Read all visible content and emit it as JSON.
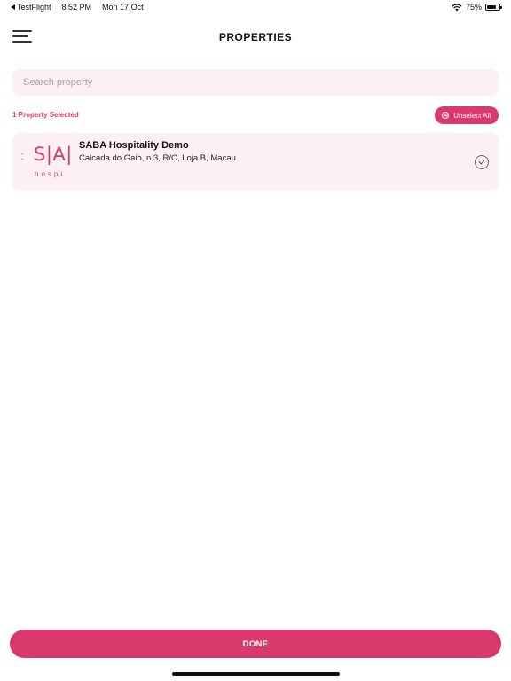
{
  "status_bar": {
    "back_app": "TestFlight",
    "time": "8:52 PM",
    "date": "Mon 17 Oct",
    "battery": "75%",
    "battery_level": 0.75,
    "icons": [
      "back-arrow-icon",
      "wifi-icon",
      "battery-icon"
    ]
  },
  "nav": {
    "title": "PROPERTIES",
    "menu_icon": "hamburger-menu-icon"
  },
  "search": {
    "placeholder": "Search property",
    "value": ""
  },
  "selection": {
    "count_text": "1 Property Selected",
    "unselect_label": "Unselect All",
    "unselect_icon": "check-circle-icon"
  },
  "properties": [
    {
      "name": "SABA Hospitality Demo",
      "address": "Calcada do Gaio, n 3, R/C, Loja B, Macau",
      "logo_mark": "S|A|",
      "logo_sub": "hospi",
      "selected": true,
      "selected_icon": "check-circle-icon"
    }
  ],
  "footer": {
    "done_label": "DONE"
  },
  "colors": {
    "accent": "#da3a6b",
    "card_bg": "#fdf0f4",
    "text": "#111111"
  }
}
